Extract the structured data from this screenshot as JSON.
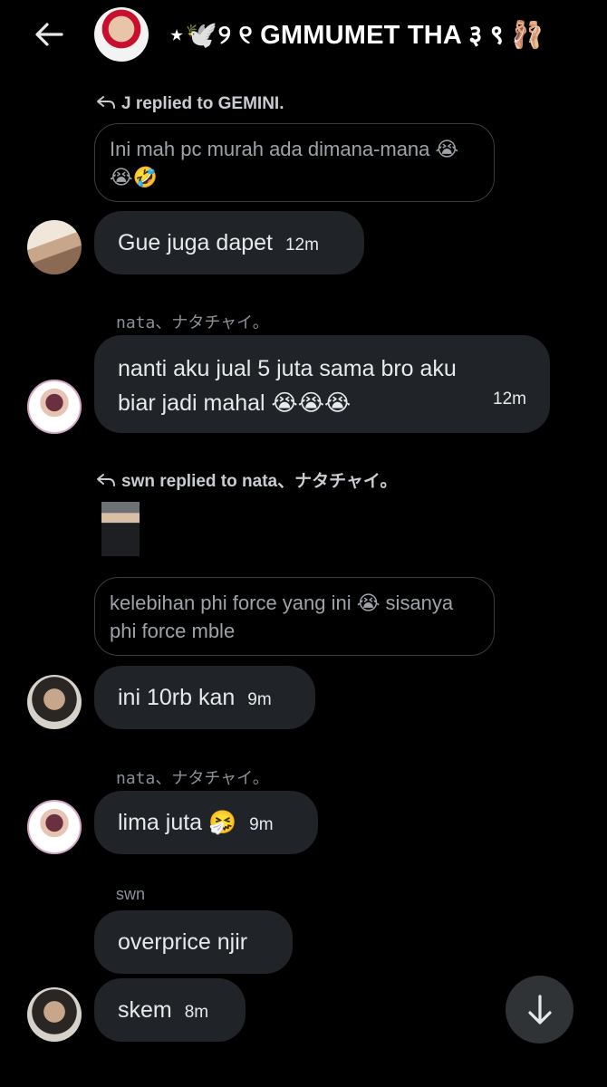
{
  "header": {
    "title": "⋆🕊️୨ ୧ GMMUMET THA ३ ९ 🩰",
    "back_icon": "arrow-left-icon",
    "avatar_icon": "group-avatar"
  },
  "messages": [
    {
      "reply_note": "J replied to GEMINI.",
      "quoted": "Ini mah pc murah ada dimana-mana 😭😭🤣",
      "text": "Gue juga dapet",
      "time": "12m"
    },
    {
      "sender": "nata、ナタチャイ。",
      "text": "nanti aku jual 5 juta sama bro aku biar jadi mahal 😭😭😭",
      "time": "12m"
    },
    {
      "reply_note": "swn replied to nata、ナタチャイ。",
      "quoted": "kelebihan phi force yang ini 😭 sisanya phi force mble",
      "text": "ini 10rb kan",
      "time": "9m"
    },
    {
      "sender": "nata、ナタチャイ。",
      "text": "lima juta 🤧",
      "time": "9m"
    },
    {
      "sender": "swn",
      "text": "overprice njir"
    },
    {
      "text": "skem",
      "time": "8m"
    }
  ],
  "scroll_button": {
    "icon": "arrow-down-icon"
  },
  "colors": {
    "background": "#000000",
    "bubble": "#202327",
    "muted": "#8b9096"
  }
}
